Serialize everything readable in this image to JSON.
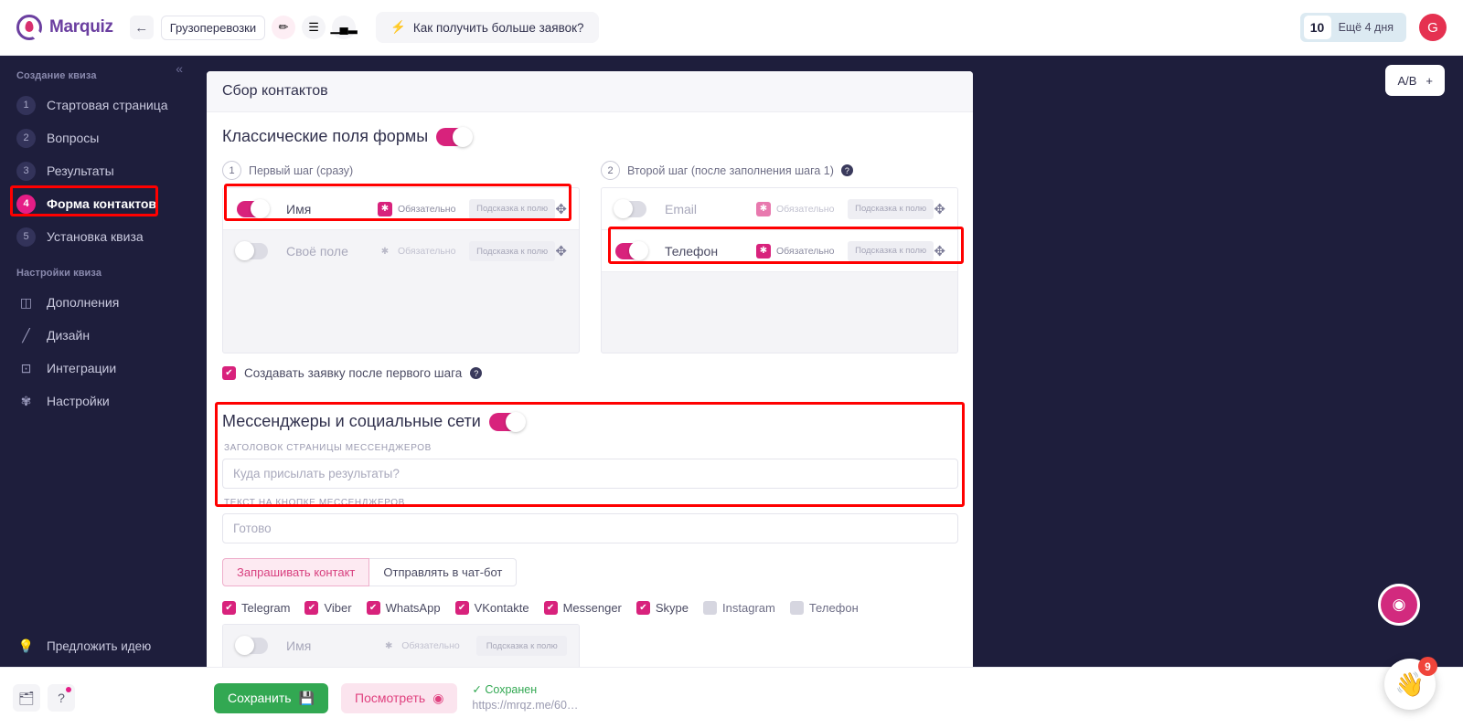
{
  "topbar": {
    "brand": "Marquiz",
    "back_icon": "arrow-left-icon",
    "quiz_name": "Грузоперевозки",
    "tools": [
      {
        "name": "edit-pencil-icon",
        "glyph": "✏️"
      },
      {
        "name": "list-icon",
        "glyph": "☰"
      },
      {
        "name": "chart-bar-icon",
        "glyph": "▪▮▫"
      }
    ],
    "promo_icon": "lightning-icon",
    "promo_label": "Как получить больше заявок?",
    "credits_count": "10",
    "credits_label": "Ещё 4 дня",
    "avatar_letter": "G"
  },
  "sidebar": {
    "collapse_icon": "chevron-double-left-icon",
    "group_build": "Создание квиза",
    "build_items": [
      {
        "num": "1",
        "label": "Стартовая страница",
        "active": false
      },
      {
        "num": "2",
        "label": "Вопросы",
        "active": false
      },
      {
        "num": "3",
        "label": "Результаты",
        "active": false
      },
      {
        "num": "4",
        "label": "Форма контактов",
        "active": true
      },
      {
        "num": "5",
        "label": "Установка квиза",
        "active": false
      }
    ],
    "group_settings": "Настройки квиза",
    "settings_items": [
      {
        "icon": "tag-icon",
        "glyph": "◫",
        "label": "Дополнения"
      },
      {
        "icon": "brush-icon",
        "glyph": "╱",
        "label": "Дизайн"
      },
      {
        "icon": "integration-icon",
        "glyph": "⊡",
        "label": "Интеграции"
      },
      {
        "icon": "gear-icon",
        "glyph": "✿",
        "label": "Настройки"
      }
    ],
    "suggest_icon": "lightbulb-icon",
    "suggest_label": "Предложить идею"
  },
  "main": {
    "ab_label": "A/B",
    "ab_plus": "+",
    "eye_icon": "eye-icon",
    "wave_icon": "waving-hand-icon",
    "wave_badge": "9",
    "card_title": "Сбор контактов",
    "classic": {
      "title": "Классические поля формы",
      "toggle_on": true,
      "step1": {
        "num": "1",
        "label": "Первый шаг (сразу)",
        "has_help": false,
        "rows": [
          {
            "name": "Имя",
            "enabled": true,
            "required": true,
            "required_label": "Обязательно",
            "hint": "Подсказка к полю",
            "drag": "move-icon",
            "highlighted": true
          },
          {
            "name": "Своё поле",
            "enabled": false,
            "required": false,
            "required_label": "Обязательно",
            "hint": "Подсказка к полю",
            "drag": "move-icon",
            "highlighted": false
          }
        ]
      },
      "step2": {
        "num": "2",
        "label": "Второй шаг (после заполнения шага 1)",
        "has_help": true,
        "rows": [
          {
            "name": "Email",
            "enabled": false,
            "required": true,
            "required_label": "Обязательно",
            "hint": "Подсказка к полю",
            "drag": "move-icon",
            "highlighted": false
          },
          {
            "name": "Телефон",
            "enabled": true,
            "required": true,
            "required_label": "Обязательно",
            "hint": "Подсказка к полю",
            "drag": "move-icon",
            "highlighted": true
          }
        ]
      },
      "create_lead_checked": true,
      "create_lead_label": "Создавать заявку после первого шага"
    },
    "messengers": {
      "title": "Мессенджеры и социальные сети",
      "toggle_on": true,
      "page_title_label": "ЗАГОЛОВОК СТРАНИЦЫ МЕССЕНДЖЕРОВ",
      "page_title_value": "",
      "page_title_placeholder": "Куда присылать результаты?",
      "button_text_label": "ТЕКСТ НА КНОПКЕ МЕССЕНДЖЕРОВ",
      "button_text_value": "",
      "button_text_placeholder": "Готово",
      "tabs": [
        {
          "label": "Запрашивать контакт",
          "active": true
        },
        {
          "label": "Отправлять в чат-бот",
          "active": false
        }
      ],
      "channels": [
        {
          "label": "Telegram",
          "checked": true
        },
        {
          "label": "Viber",
          "checked": true
        },
        {
          "label": "WhatsApp",
          "checked": true
        },
        {
          "label": "VKontakte",
          "checked": true
        },
        {
          "label": "Messenger",
          "checked": true
        },
        {
          "label": "Skype",
          "checked": true
        },
        {
          "label": "Instagram",
          "checked": false
        },
        {
          "label": "Телефон",
          "checked": false
        }
      ],
      "last_row": {
        "name": "Имя",
        "enabled": false,
        "required": false,
        "required_label": "Обязательно",
        "hint": "Подсказка к полю",
        "drag": "move-icon"
      }
    }
  },
  "bottombar": {
    "history_icon": "folder-clock-icon",
    "help_icon": "question-icon",
    "save_label": "Сохранить",
    "save_icon": "floppy-icon",
    "view_label": "Посмотреть",
    "view_icon": "eye-icon",
    "saved_status": "✓ Сохранен",
    "saved_url": "https://mrqz.me/60…"
  },
  "colors": {
    "accent_pink": "#d8227c",
    "sidebar_bg": "#1e1e3c",
    "save_green": "#32a852",
    "highlight_red": "#ff0000"
  }
}
